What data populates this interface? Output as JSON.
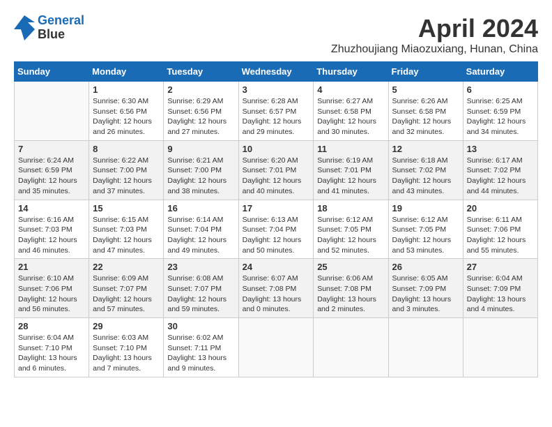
{
  "header": {
    "logo_line1": "General",
    "logo_line2": "Blue",
    "month_title": "April 2024",
    "subtitle": "Zhuzhoujiang Miaozuxiang, Hunan, China"
  },
  "weekdays": [
    "Sunday",
    "Monday",
    "Tuesday",
    "Wednesday",
    "Thursday",
    "Friday",
    "Saturday"
  ],
  "weeks": [
    [
      {
        "day": "",
        "sunrise": "",
        "sunset": "",
        "daylight": ""
      },
      {
        "day": "1",
        "sunrise": "Sunrise: 6:30 AM",
        "sunset": "Sunset: 6:56 PM",
        "daylight": "Daylight: 12 hours and 26 minutes."
      },
      {
        "day": "2",
        "sunrise": "Sunrise: 6:29 AM",
        "sunset": "Sunset: 6:56 PM",
        "daylight": "Daylight: 12 hours and 27 minutes."
      },
      {
        "day": "3",
        "sunrise": "Sunrise: 6:28 AM",
        "sunset": "Sunset: 6:57 PM",
        "daylight": "Daylight: 12 hours and 29 minutes."
      },
      {
        "day": "4",
        "sunrise": "Sunrise: 6:27 AM",
        "sunset": "Sunset: 6:58 PM",
        "daylight": "Daylight: 12 hours and 30 minutes."
      },
      {
        "day": "5",
        "sunrise": "Sunrise: 6:26 AM",
        "sunset": "Sunset: 6:58 PM",
        "daylight": "Daylight: 12 hours and 32 minutes."
      },
      {
        "day": "6",
        "sunrise": "Sunrise: 6:25 AM",
        "sunset": "Sunset: 6:59 PM",
        "daylight": "Daylight: 12 hours and 34 minutes."
      }
    ],
    [
      {
        "day": "7",
        "sunrise": "Sunrise: 6:24 AM",
        "sunset": "Sunset: 6:59 PM",
        "daylight": "Daylight: 12 hours and 35 minutes."
      },
      {
        "day": "8",
        "sunrise": "Sunrise: 6:22 AM",
        "sunset": "Sunset: 7:00 PM",
        "daylight": "Daylight: 12 hours and 37 minutes."
      },
      {
        "day": "9",
        "sunrise": "Sunrise: 6:21 AM",
        "sunset": "Sunset: 7:00 PM",
        "daylight": "Daylight: 12 hours and 38 minutes."
      },
      {
        "day": "10",
        "sunrise": "Sunrise: 6:20 AM",
        "sunset": "Sunset: 7:01 PM",
        "daylight": "Daylight: 12 hours and 40 minutes."
      },
      {
        "day": "11",
        "sunrise": "Sunrise: 6:19 AM",
        "sunset": "Sunset: 7:01 PM",
        "daylight": "Daylight: 12 hours and 41 minutes."
      },
      {
        "day": "12",
        "sunrise": "Sunrise: 6:18 AM",
        "sunset": "Sunset: 7:02 PM",
        "daylight": "Daylight: 12 hours and 43 minutes."
      },
      {
        "day": "13",
        "sunrise": "Sunrise: 6:17 AM",
        "sunset": "Sunset: 7:02 PM",
        "daylight": "Daylight: 12 hours and 44 minutes."
      }
    ],
    [
      {
        "day": "14",
        "sunrise": "Sunrise: 6:16 AM",
        "sunset": "Sunset: 7:03 PM",
        "daylight": "Daylight: 12 hours and 46 minutes."
      },
      {
        "day": "15",
        "sunrise": "Sunrise: 6:15 AM",
        "sunset": "Sunset: 7:03 PM",
        "daylight": "Daylight: 12 hours and 47 minutes."
      },
      {
        "day": "16",
        "sunrise": "Sunrise: 6:14 AM",
        "sunset": "Sunset: 7:04 PM",
        "daylight": "Daylight: 12 hours and 49 minutes."
      },
      {
        "day": "17",
        "sunrise": "Sunrise: 6:13 AM",
        "sunset": "Sunset: 7:04 PM",
        "daylight": "Daylight: 12 hours and 50 minutes."
      },
      {
        "day": "18",
        "sunrise": "Sunrise: 6:12 AM",
        "sunset": "Sunset: 7:05 PM",
        "daylight": "Daylight: 12 hours and 52 minutes."
      },
      {
        "day": "19",
        "sunrise": "Sunrise: 6:12 AM",
        "sunset": "Sunset: 7:05 PM",
        "daylight": "Daylight: 12 hours and 53 minutes."
      },
      {
        "day": "20",
        "sunrise": "Sunrise: 6:11 AM",
        "sunset": "Sunset: 7:06 PM",
        "daylight": "Daylight: 12 hours and 55 minutes."
      }
    ],
    [
      {
        "day": "21",
        "sunrise": "Sunrise: 6:10 AM",
        "sunset": "Sunset: 7:06 PM",
        "daylight": "Daylight: 12 hours and 56 minutes."
      },
      {
        "day": "22",
        "sunrise": "Sunrise: 6:09 AM",
        "sunset": "Sunset: 7:07 PM",
        "daylight": "Daylight: 12 hours and 57 minutes."
      },
      {
        "day": "23",
        "sunrise": "Sunrise: 6:08 AM",
        "sunset": "Sunset: 7:07 PM",
        "daylight": "Daylight: 12 hours and 59 minutes."
      },
      {
        "day": "24",
        "sunrise": "Sunrise: 6:07 AM",
        "sunset": "Sunset: 7:08 PM",
        "daylight": "Daylight: 13 hours and 0 minutes."
      },
      {
        "day": "25",
        "sunrise": "Sunrise: 6:06 AM",
        "sunset": "Sunset: 7:08 PM",
        "daylight": "Daylight: 13 hours and 2 minutes."
      },
      {
        "day": "26",
        "sunrise": "Sunrise: 6:05 AM",
        "sunset": "Sunset: 7:09 PM",
        "daylight": "Daylight: 13 hours and 3 minutes."
      },
      {
        "day": "27",
        "sunrise": "Sunrise: 6:04 AM",
        "sunset": "Sunset: 7:09 PM",
        "daylight": "Daylight: 13 hours and 4 minutes."
      }
    ],
    [
      {
        "day": "28",
        "sunrise": "Sunrise: 6:04 AM",
        "sunset": "Sunset: 7:10 PM",
        "daylight": "Daylight: 13 hours and 6 minutes."
      },
      {
        "day": "29",
        "sunrise": "Sunrise: 6:03 AM",
        "sunset": "Sunset: 7:10 PM",
        "daylight": "Daylight: 13 hours and 7 minutes."
      },
      {
        "day": "30",
        "sunrise": "Sunrise: 6:02 AM",
        "sunset": "Sunset: 7:11 PM",
        "daylight": "Daylight: 13 hours and 9 minutes."
      },
      {
        "day": "",
        "sunrise": "",
        "sunset": "",
        "daylight": ""
      },
      {
        "day": "",
        "sunrise": "",
        "sunset": "",
        "daylight": ""
      },
      {
        "day": "",
        "sunrise": "",
        "sunset": "",
        "daylight": ""
      },
      {
        "day": "",
        "sunrise": "",
        "sunset": "",
        "daylight": ""
      }
    ]
  ]
}
